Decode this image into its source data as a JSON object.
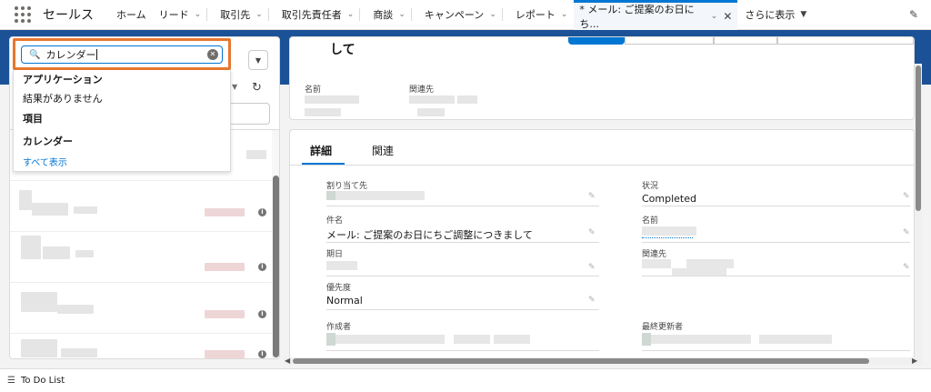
{
  "nav": {
    "app_name": "セールス",
    "items": [
      {
        "label": "ホーム",
        "chevron": false
      },
      {
        "label": "リード",
        "chevron": true
      },
      {
        "label": "取引先",
        "chevron": true
      },
      {
        "label": "取引先責任者",
        "chevron": true
      },
      {
        "label": "商談",
        "chevron": true
      },
      {
        "label": "キャンペーン",
        "chevron": true
      },
      {
        "label": "レポート",
        "chevron": true
      }
    ],
    "active_tab": "* メール: ご提案のお日にち...",
    "more_label": "さらに表示"
  },
  "search": {
    "value": "カレンダー",
    "sections": {
      "applications": "アプリケーション",
      "no_results": "結果がありません",
      "items": "項目",
      "calendar": "カレンダー",
      "show_all": "すべて表示"
    }
  },
  "record": {
    "title": "して",
    "header_fields": {
      "name_label": "名前",
      "related_label": "関連先"
    }
  },
  "details": {
    "tabs": {
      "detail": "詳細",
      "related": "関連"
    },
    "fields": {
      "assigned_label": "割り当て先",
      "status_label": "状況",
      "status_value": "Completed",
      "subject_label": "件名",
      "subject_value": "メール: ご提案のお日にちご調整につきまして",
      "name_label": "名前",
      "due_label": "期日",
      "related_label": "関連先",
      "priority_label": "優先度",
      "priority_value": "Normal",
      "created_label": "作成者",
      "modified_label": "最終更新者"
    }
  },
  "footer": {
    "todo": "To Do List"
  },
  "colors": {
    "accent": "#0176d3",
    "band": "#1b5297",
    "highlight": "#e6772e"
  }
}
